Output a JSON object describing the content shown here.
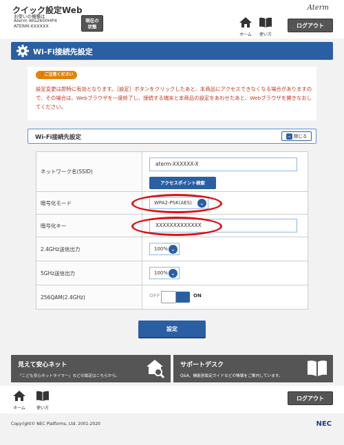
{
  "header": {
    "app_title": "クイック設定Web",
    "model_label": "お使いの機種は",
    "model_name": "Aterm WG2600HP4",
    "model_id": "ATERM-XXXXXX",
    "status_button": "現在の\n状態",
    "brand": "Aterm",
    "nav_home": "ホーム",
    "nav_guide": "使い方",
    "logout": "ログアウト"
  },
  "page": {
    "title": "Wi-Fi接続先設定"
  },
  "notice": {
    "badge": "ご注意ください",
    "text": "設定変更は即時に有効となります。［設定］ボタンをクリックしたあと、本商品にアクセスできなくなる場合がありますので、その場合は、Webブラウザを一度終了し、接続する端末と本商品の設定をあわせたあと、Webブラウザを開きなおしてください。"
  },
  "panel": {
    "title": "Wi-Fi接続先設定",
    "close_button": "閉じる",
    "rows": {
      "ssid_label": "ネットワーク名(SSID)",
      "ssid_value": "aterm-XXXXXX-X",
      "ap_search_button": "アクセスポイント検索",
      "enc_mode_label": "暗号化モード",
      "enc_mode_value": "WPA2-PSK(AES)",
      "enc_key_label": "暗号化キー",
      "enc_key_value": "XXXXXXXXXXXXX",
      "tx24_label": "2.4GHz送信出力",
      "tx24_value": "100%",
      "tx5_label": "5GHz送信出力",
      "tx5_value": "100%",
      "qam_label": "256QAM(2.4GHz)",
      "qam_off": "OFF",
      "qam_on": "ON"
    }
  },
  "submit_button": "設定",
  "banners": {
    "left_title": "見えて安心ネット",
    "left_sub": "「こども安心ネットタイマー」などの設定はこちらから。",
    "right_title": "サポートデスク",
    "right_sub": "Q&A、機能別設定ガイドなどの情報をご案内しています。"
  },
  "footer": {
    "nav_home": "ホーム",
    "nav_guide": "使い方",
    "logout": "ログアウト",
    "copyright": "Copyright© NEC Platforms, Ltd. 2001-2020",
    "brand": "NEC"
  },
  "colors": {
    "primary": "#2a5fa3",
    "warning": "#e2820a",
    "notice_text": "#c0331f",
    "highlight_oval": "#e01010"
  }
}
